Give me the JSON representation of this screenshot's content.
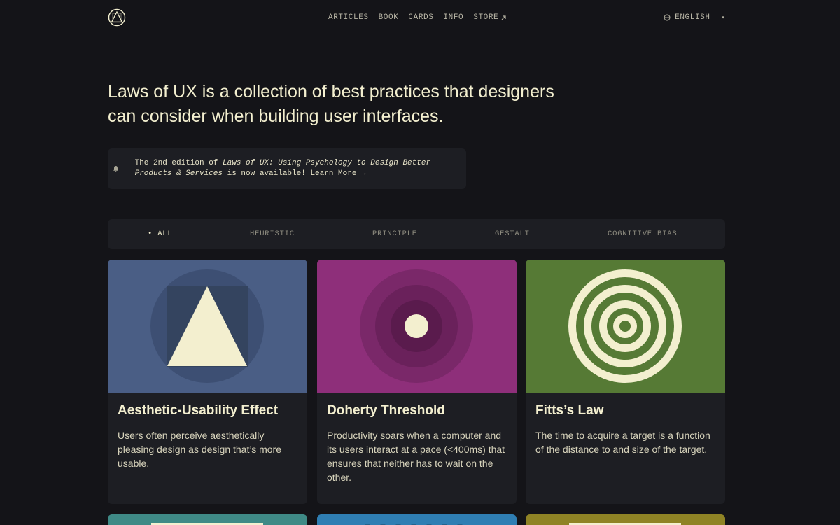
{
  "nav": {
    "items": [
      {
        "label": "ARTICLES"
      },
      {
        "label": "BOOK"
      },
      {
        "label": "CARDS"
      },
      {
        "label": "INFO"
      },
      {
        "label": "STORE"
      }
    ],
    "language": "ENGLISH"
  },
  "hero": {
    "headline": "Laws of UX is a collection of best practices that designers can consider when building user interfaces."
  },
  "notice": {
    "prefix": "The 2nd edition of ",
    "book_title": "Laws of UX: Using Psychology to Design Better Products & Services",
    "suffix": " is now available! ",
    "link": "Learn More →"
  },
  "filters": {
    "items": [
      {
        "label": "• ALL"
      },
      {
        "label": "HEURISTIC"
      },
      {
        "label": "PRINCIPLE"
      },
      {
        "label": "GESTALT"
      },
      {
        "label": "COGNITIVE BIAS"
      }
    ],
    "active": "ALL"
  },
  "cards": [
    {
      "title": "Aesthetic-Usability Effect",
      "description": "Users often perceive aesthetically pleasing design as design that’s more usable.",
      "color": "#4a5e85"
    },
    {
      "title": "Doherty Threshold",
      "description": "Productivity soars when a computer and its users interact at a pace (<400ms) that ensures that neither has to wait on the other.",
      "color": "#8e2f7a"
    },
    {
      "title": "Fitts’s Law",
      "description": "The time to acquire a target is a function of the distance to and size of the target.",
      "color": "#567a35"
    }
  ],
  "peek_colors": [
    "#3f8a86",
    "#2f7eb3",
    "#8f8325"
  ],
  "colors": {
    "background": "#141418",
    "card": "#1d1e23",
    "cream": "#f3efcf"
  }
}
